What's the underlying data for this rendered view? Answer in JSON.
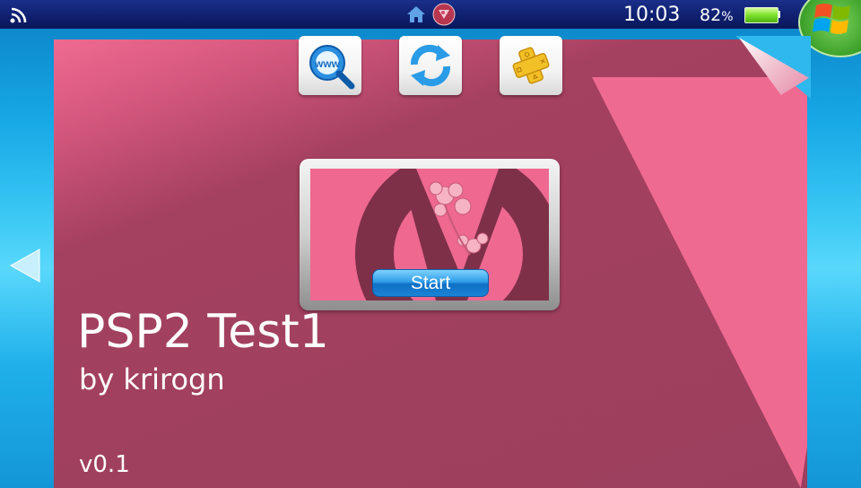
{
  "status_bar": {
    "clock": "10:03",
    "battery_percent": "82",
    "battery_unit": "%",
    "battery_level": 0.82,
    "icons": [
      "wifi-icon",
      "home-icon",
      "notification-icon",
      "windows-logo-icon"
    ]
  },
  "toolbar": {
    "buttons": [
      {
        "name": "browser-button",
        "icon": "www-search-icon"
      },
      {
        "name": "refresh-button",
        "icon": "refresh-icon"
      },
      {
        "name": "playstation-plus-button",
        "icon": "ps-plus-icon"
      }
    ]
  },
  "app": {
    "title": "PSP2 Test1",
    "author": "by krirogn",
    "version": "v0.1",
    "start_label": "Start"
  },
  "colors": {
    "card_pink": "#ef6a90",
    "card_dark": "#9c3f5e",
    "status_bar": "#0f1f6e",
    "start_button": "#1a83d6"
  }
}
